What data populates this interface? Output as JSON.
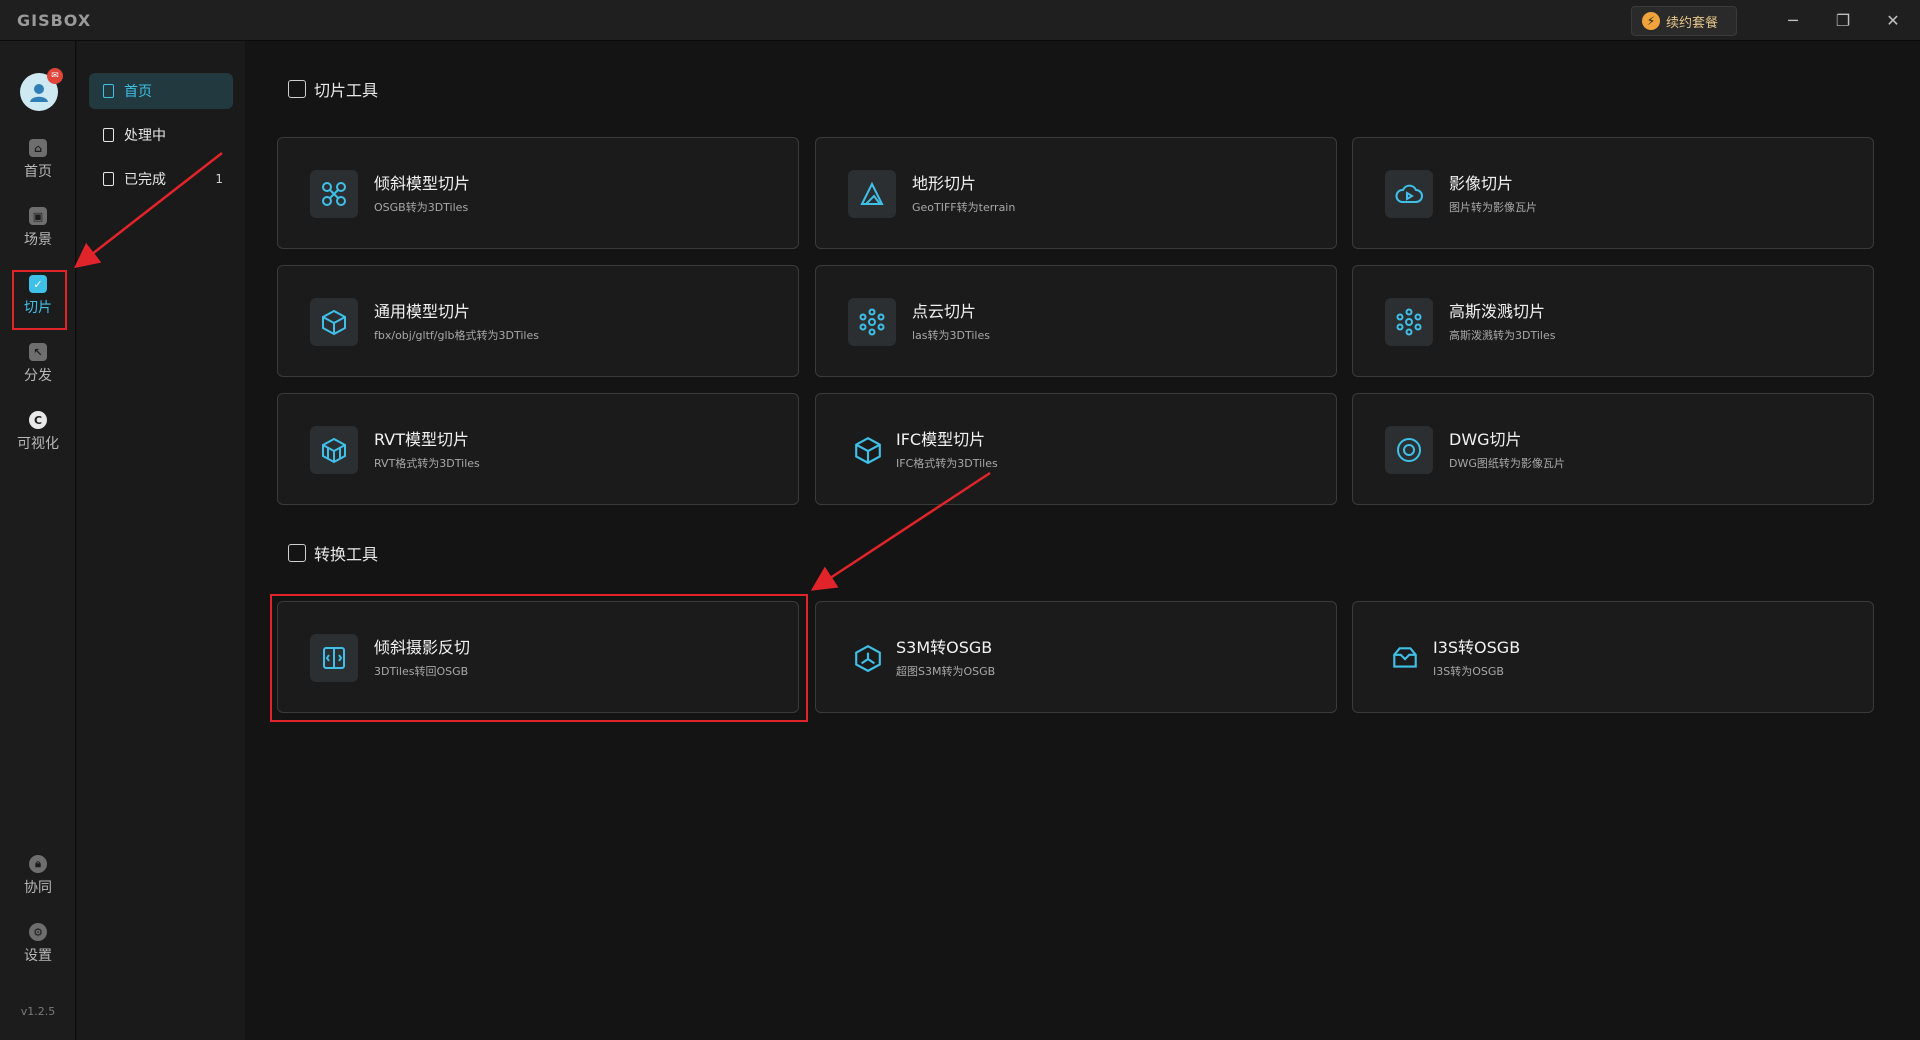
{
  "titlebar": {
    "logo": "GISBOX",
    "renew_label": "续约套餐",
    "minimize_icon": "minimize-icon",
    "maximize_icon": "restore-icon",
    "close_icon": "close-icon"
  },
  "rail": {
    "avatar_badge": "",
    "items": [
      {
        "label": "首页",
        "icon": "home-icon"
      },
      {
        "label": "场景",
        "icon": "cube-icon"
      },
      {
        "label": "切片",
        "icon": "slice-icon"
      },
      {
        "label": "分发",
        "icon": "share-icon"
      },
      {
        "label": "可视化",
        "icon": "visual-icon"
      },
      {
        "label": "协同",
        "icon": "lock-icon"
      },
      {
        "label": "设置",
        "icon": "gear-icon"
      }
    ],
    "version": "v1.2.5"
  },
  "nav": {
    "items": [
      {
        "label": "首页",
        "count": ""
      },
      {
        "label": "处理中",
        "count": ""
      },
      {
        "label": "已完成",
        "count": "1"
      }
    ]
  },
  "main": {
    "slice_title": "切片工具",
    "convert_title": "转换工具",
    "slice_cards": [
      {
        "title": "倾斜模型切片",
        "subtitle": "OSGB转为3DTiles",
        "icon": "drone-icon"
      },
      {
        "title": "地形切片",
        "subtitle": "GeoTIFF转为terrain",
        "icon": "terrain-icon"
      },
      {
        "title": "影像切片",
        "subtitle": "图片转为影像瓦片",
        "icon": "cloud-play-icon"
      },
      {
        "title": "通用模型切片",
        "subtitle": "fbx/obj/gltf/glb格式转为3DTiles",
        "icon": "box-icon"
      },
      {
        "title": "点云切片",
        "subtitle": "las转为3DTiles",
        "icon": "point-cloud-icon"
      },
      {
        "title": "高斯泼溅切片",
        "subtitle": "高斯泼溅转为3DTiles",
        "icon": "gaussian-icon"
      },
      {
        "title": "RVT模型切片",
        "subtitle": "RVT格式转为3DTiles",
        "icon": "rvt-icon"
      },
      {
        "title": "IFC模型切片",
        "subtitle": "IFC格式转为3DTiles",
        "icon": "ifc-cube-icon"
      },
      {
        "title": "DWG切片",
        "subtitle": "DWG图纸转为影像瓦片",
        "icon": "dwg-icon"
      }
    ],
    "convert_cards": [
      {
        "title": "倾斜摄影反切",
        "subtitle": "3DTiles转回OSGB",
        "icon": "reverse-slice-icon"
      },
      {
        "title": "S3M转OSGB",
        "subtitle": "超图S3M转为OSGB",
        "icon": "s3m-icon"
      },
      {
        "title": "I3S转OSGB",
        "subtitle": "I3S转为OSGB",
        "icon": "i3s-icon"
      }
    ]
  },
  "colors": {
    "accent": "#3fc0e8",
    "annotation_red": "#e0242a",
    "background": "#141414",
    "card_border": "#3a3a3a"
  }
}
